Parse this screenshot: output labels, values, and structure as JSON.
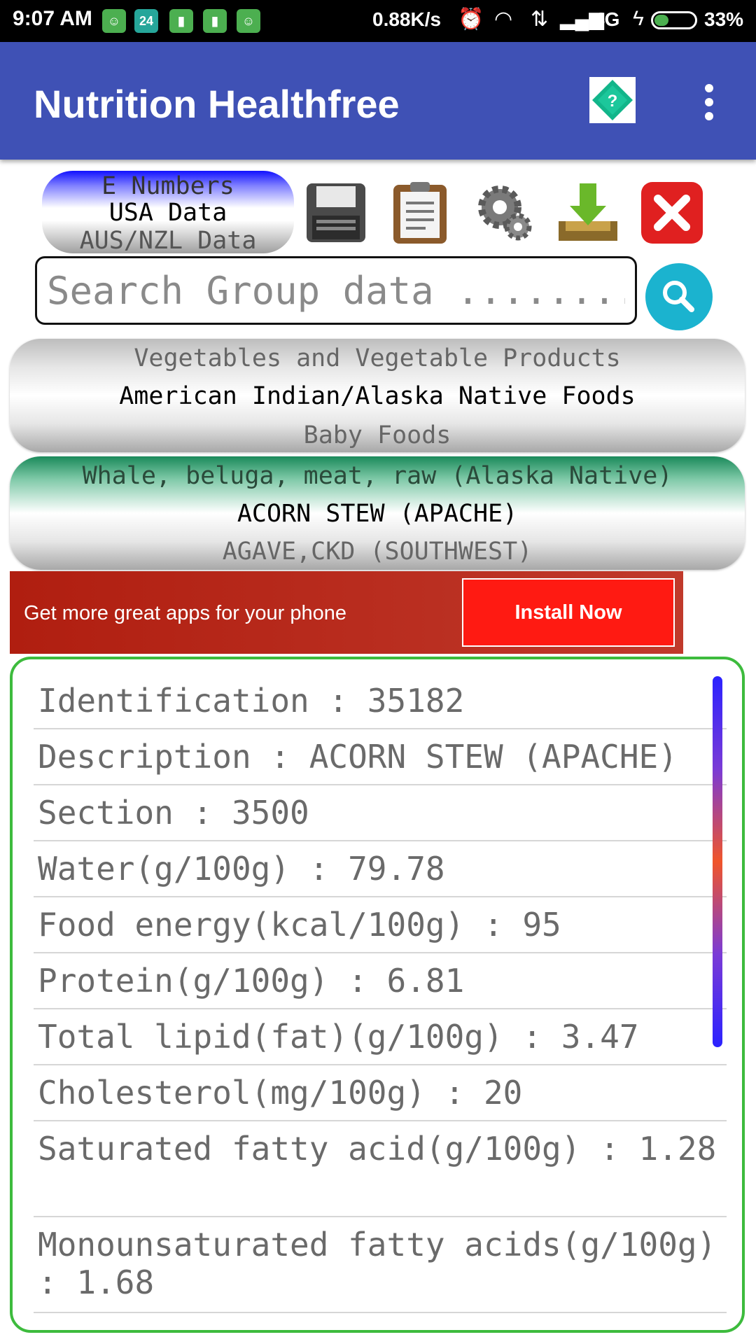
{
  "status_bar": {
    "time": "9:07 AM",
    "notification_badge": "24",
    "net_speed": "0.88K/s",
    "network": "4G",
    "battery": "33%"
  },
  "app_bar": {
    "title": "Nutrition Healthfree",
    "help_label": "?"
  },
  "database_selector": {
    "options": [
      "E Numbers",
      "USA Data",
      "AUS/NZL Data"
    ],
    "selected": "USA Data"
  },
  "toolbar_icons": [
    "save-icon",
    "clipboard-icon",
    "settings-icon",
    "download-icon",
    "close-icon"
  ],
  "search": {
    "placeholder": "Search Group data ........"
  },
  "group_picker": {
    "above": "Vegetables and Vegetable Products",
    "selected": "American Indian/Alaska Native Foods",
    "below": "Baby Foods"
  },
  "food_picker": {
    "above": "Whale, beluga, meat, raw (Alaska Native)",
    "selected": "ACORN STEW (APACHE)",
    "below": "AGAVE,CKD (SOUTHWEST)"
  },
  "ad": {
    "text": "Get more great apps for your phone",
    "button": "Install Now"
  },
  "details": [
    "Identification : 35182",
    "Description : ACORN STEW (APACHE)",
    "Section : 3500",
    "Water(g/100g) : 79.78",
    "Food energy(kcal/100g) : 95",
    "Protein(g/100g) : 6.81",
    "Total lipid(fat)(g/100g) : 3.47",
    "Cholesterol(mg/100g) : 20",
    "Saturated fatty acid(g/100g) : 1.28",
    "Monounsaturated fatty acids(g/100g) : 1.68"
  ],
  "colors": {
    "app_bar": "#3f51b5",
    "card_border": "#3dbb3d",
    "search_button": "#1bb3cf",
    "ad_background": "#b01e10",
    "install_button": "#ff1a12"
  }
}
